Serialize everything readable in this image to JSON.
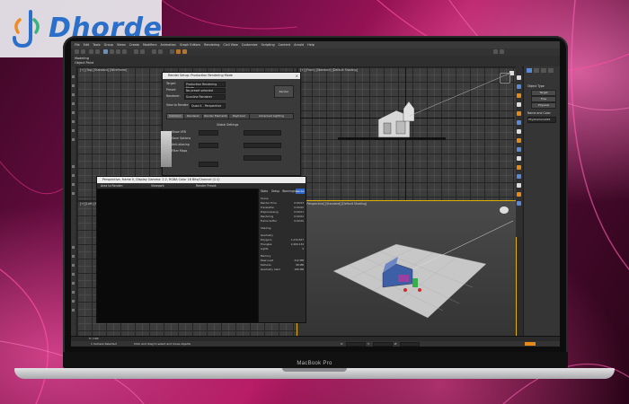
{
  "brand": {
    "logo_text": "Dhorde",
    "laptop_model": "MacBook Pro"
  },
  "app": {
    "menu": [
      "File",
      "Edit",
      "Tools",
      "Group",
      "Views",
      "Create",
      "Modifiers",
      "Animation",
      "Graph Editors",
      "Rendering",
      "Civil View",
      "Customize",
      "Scripting",
      "Content",
      "Arnold",
      "Help"
    ],
    "ribbon_tabs": [
      "Modeling",
      "Object Paint"
    ],
    "viewports": {
      "top_left": "[+] [Top] [Standard] [Wireframe]",
      "top_right": "[+] [Front] [Standard] [Default Shading]",
      "bottom_left": "[+] [Left] [Standard] [Wireframe]",
      "bottom_right": "[+] [Perspective] [Standard] [Default Shading]"
    },
    "command_panel": {
      "section": "Object Type",
      "buttons": [
        "Target",
        "Free",
        "Physical"
      ],
      "name_label": "Name and Color",
      "name_value": "PhysCamera001"
    }
  },
  "render_setup": {
    "title": "Render Setup: Production Rendering Mode",
    "fields": [
      {
        "label": "Target:",
        "value": "Production Rendering Mode"
      },
      {
        "label": "Preset:",
        "value": "No preset selected"
      },
      {
        "label": "Renderer:",
        "value": "Scanline Renderer"
      },
      {
        "label": "View to Render:",
        "value": "Quad 4 - Perspective"
      }
    ],
    "render_button": "Render",
    "tabs": [
      "Common",
      "Renderer",
      "Render Elements",
      "Raytracer",
      "Advanced Lighting"
    ],
    "sections": [
      "Global Settings",
      "Show VFB",
      "Save Options",
      "Anti-aliasing",
      "Filter Maps"
    ]
  },
  "frame_buffer": {
    "title": "Perspective, frame 0, Display Gamma: 2.2, RGBA Color 16 Bits/Channel (1:1)",
    "toolbar": [
      "Area to Render:",
      "Viewport:",
      "Render Preset:"
    ],
    "side_tabs": [
      "Stats",
      "Setup",
      "Warnings"
    ],
    "stats": [
      {
        "label": "Scene",
        "value": ""
      },
      {
        "label": "Render Time",
        "value": "0:00:03"
      },
      {
        "label": "Translation",
        "value": "0:00:00"
      },
      {
        "label": "Preprocessing",
        "value": "0:00:01"
      },
      {
        "label": "Rendering",
        "value": "0:00:02"
      },
      {
        "label": "Frame buffer",
        "value": "0:00:00"
      },
      {
        "label": "Shading",
        "value": ""
      },
      {
        "label": "Geometry",
        "value": ""
      },
      {
        "label": "Polygons",
        "value": "1,234,567"
      },
      {
        "label": "Triangles",
        "value": "2,469,134"
      },
      {
        "label": "Lights",
        "value": "2"
      },
      {
        "label": "Memory",
        "value": ""
      },
      {
        "label": "Peak used",
        "value": "412 MB"
      },
      {
        "label": "Textures",
        "value": "96 MB"
      },
      {
        "label": "Geometry mem",
        "value": "180 MB"
      }
    ],
    "render_button": "Render"
  },
  "status": {
    "selection": "1 Camera Selected",
    "hint": "Click and drag to select and move objects",
    "frame": "0 / 100",
    "coords": {
      "x": "X:",
      "y": "Y:",
      "z": "Z:"
    }
  },
  "colors": {
    "accent_orange": "#e58a1a",
    "viewport_highlight": "#e0b000",
    "logo_blue": "#2a6fc9"
  }
}
